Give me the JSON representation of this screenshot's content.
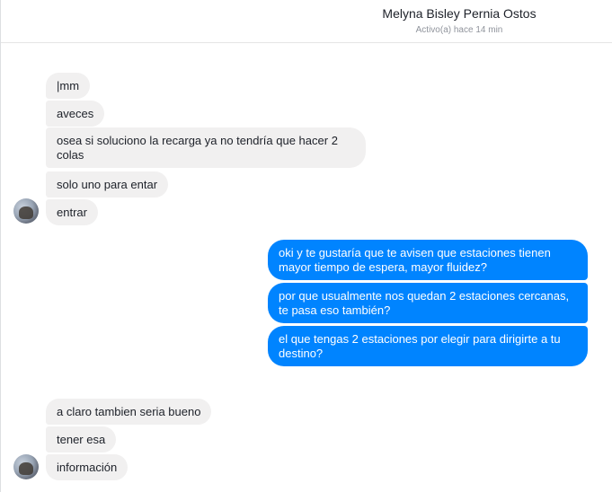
{
  "header": {
    "contact_name": "Melyna Bisley Pernia Ostos",
    "status": "Activo(a) hace 14 min"
  },
  "messages": [
    {
      "from": "contact",
      "text": "|mm"
    },
    {
      "from": "contact",
      "text": "aveces"
    },
    {
      "from": "contact",
      "text": "osea si soluciono la recarga ya no tendría que hacer 2 colas"
    },
    {
      "from": "contact",
      "text": "solo uno para entar"
    },
    {
      "from": "contact",
      "text": "entrar"
    },
    {
      "from": "me",
      "text": "oki y te gustaría que te avisen que estaciones tienen mayor tiempo de espera, mayor fluidez?"
    },
    {
      "from": "me",
      "text": "por que usualmente nos quedan 2 estaciones cercanas, te pasa eso también?"
    },
    {
      "from": "me",
      "text": "el que tengas 2 estaciones por elegir para dirigirte a tu destino?"
    },
    {
      "from": "contact",
      "text": "a claro tambien seria bueno"
    },
    {
      "from": "contact",
      "text": "tener esa"
    },
    {
      "from": "contact",
      "text": "información"
    }
  ],
  "colors": {
    "incoming_bubble": "#f1f0f0",
    "outgoing_bubble": "#0084ff",
    "name_text": "#1d2129",
    "status_text": "#90949c"
  }
}
